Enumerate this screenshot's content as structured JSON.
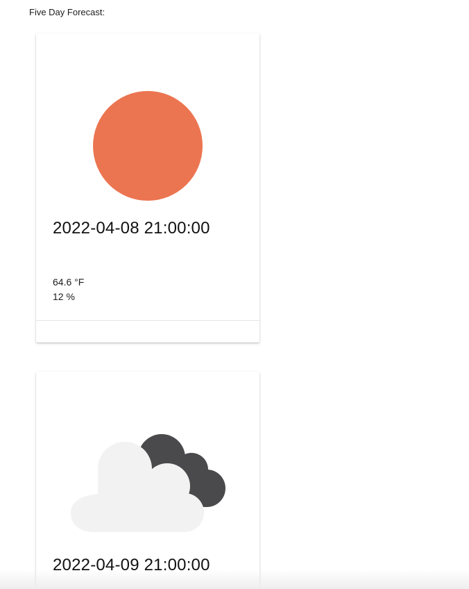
{
  "header": {
    "title": "Five Day Forecast:"
  },
  "forecast": [
    {
      "date": "2022-04-08 21:00:00",
      "icon": "sun-icon",
      "temperature": "64.6 °F",
      "humidity": "12 %"
    },
    {
      "date": "2022-04-09 21:00:00",
      "icon": "cloudy-icon"
    }
  ],
  "colors": {
    "sun": "#ec7551",
    "cloud_dark": "#4a4a4c",
    "cloud_light": "#f2f2f2"
  }
}
